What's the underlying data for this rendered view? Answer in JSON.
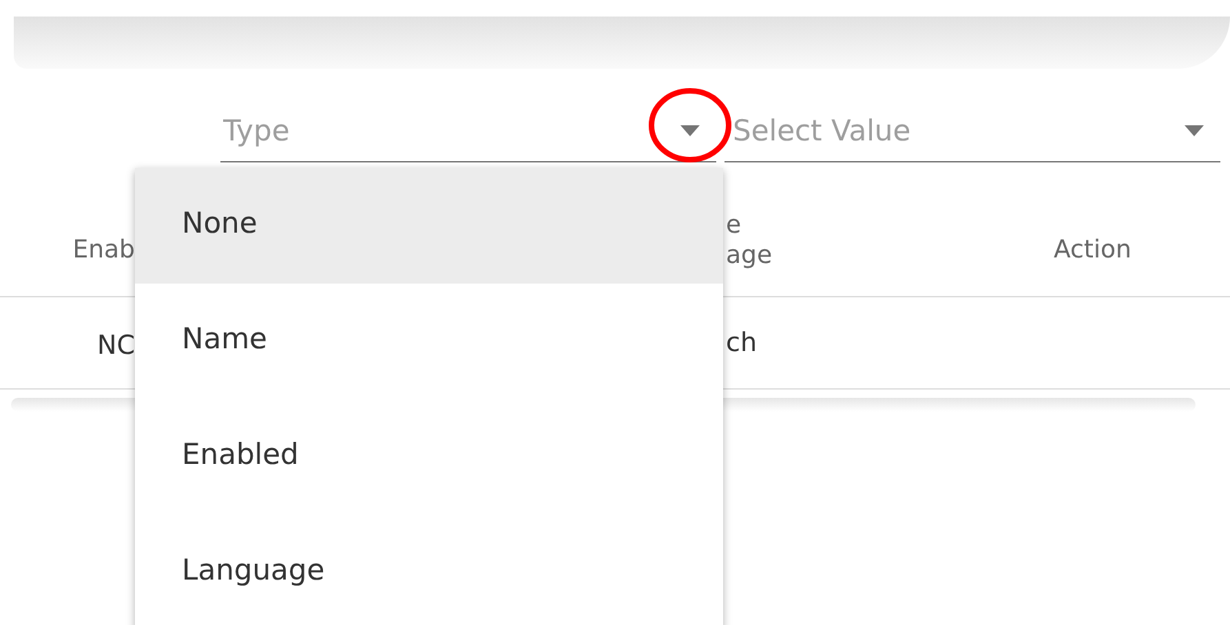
{
  "filters": [
    {
      "placeholder": "Type"
    },
    {
      "placeholder": "Select Value"
    }
  ],
  "table": {
    "columns": [
      {
        "lines": [
          "Enab"
        ]
      },
      {
        "lines": [
          "e",
          "age"
        ]
      },
      {
        "lines": [
          "Action"
        ]
      }
    ],
    "rows": [
      {
        "cells": [
          "NC",
          "ch"
        ]
      }
    ]
  },
  "dropdown": {
    "items": [
      {
        "label": "None",
        "selected": true
      },
      {
        "label": "Name",
        "selected": false
      },
      {
        "label": "Enabled",
        "selected": false
      },
      {
        "label": "Language",
        "selected": false
      }
    ]
  }
}
